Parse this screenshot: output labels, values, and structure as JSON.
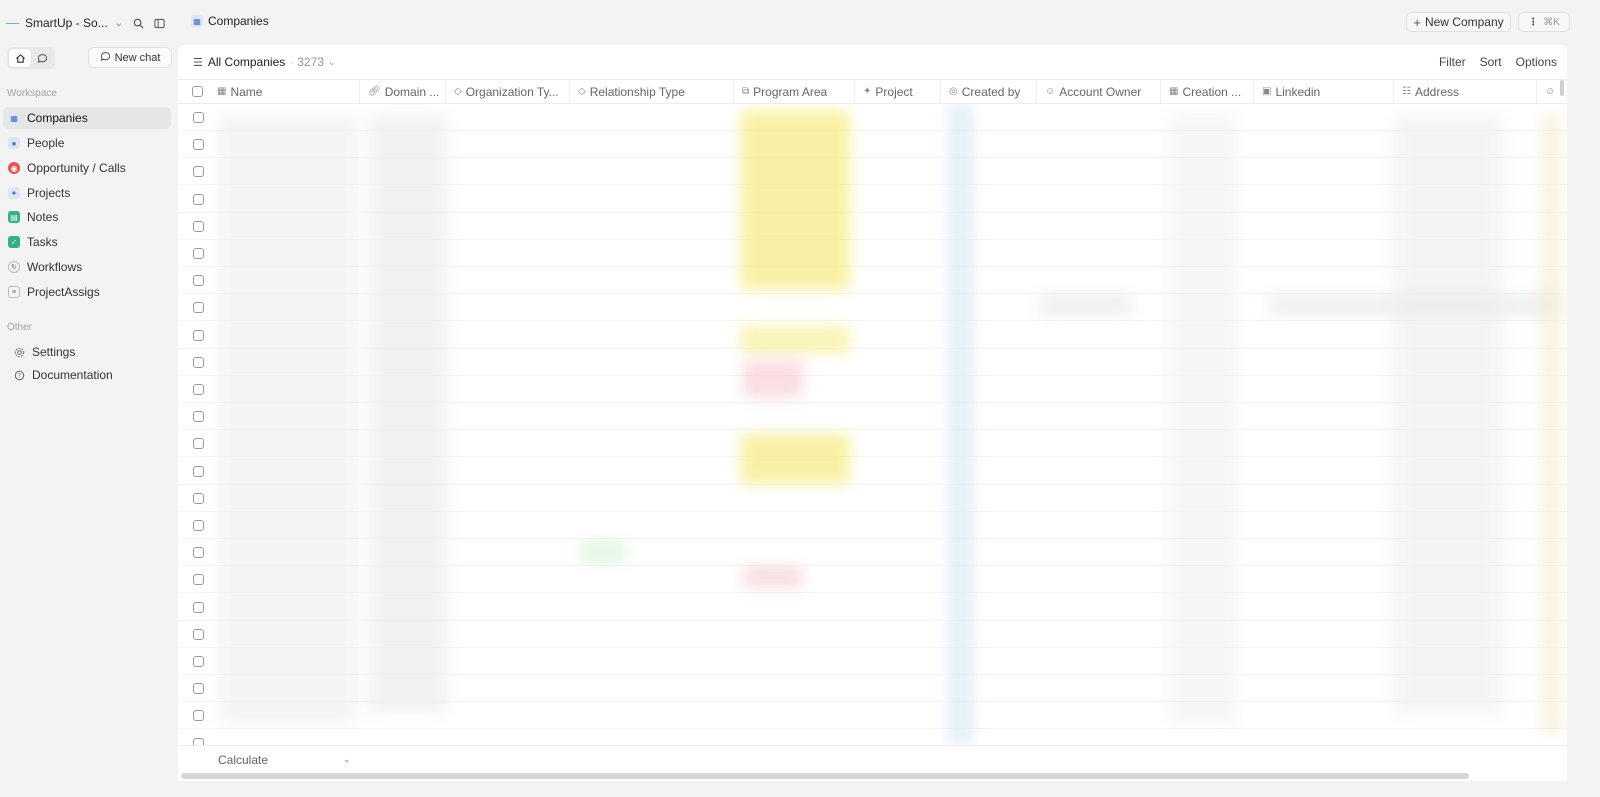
{
  "workspace": {
    "name": "SmartUp - So..."
  },
  "sidebar": {
    "new_chat_label": "New chat",
    "workspace_label": "Workspace",
    "other_label": "Other",
    "items": [
      {
        "label": "Companies",
        "icon": "building-icon",
        "color": "#5b7fd0"
      },
      {
        "label": "People",
        "icon": "person-icon",
        "color": "#5b7fd0"
      },
      {
        "label": "Opportunity / Calls",
        "icon": "target-icon",
        "color": "#d94b4b"
      },
      {
        "label": "Projects",
        "icon": "rocket-icon",
        "color": "#5b7fd0"
      },
      {
        "label": "Notes",
        "icon": "note-icon",
        "color": "#2fae7a"
      },
      {
        "label": "Tasks",
        "icon": "checkbox-icon",
        "color": "#2fae7a"
      },
      {
        "label": "Workflows",
        "icon": "workflow-icon",
        "color": "#888888"
      },
      {
        "label": "ProjectAssigs",
        "icon": "list-icon",
        "color": "#888888"
      }
    ],
    "other_items": [
      {
        "label": "Settings",
        "icon": "gear-icon"
      },
      {
        "label": "Documentation",
        "icon": "help-icon"
      }
    ]
  },
  "header": {
    "title": "Companies",
    "new_company_label": "New Company",
    "shortcut": "⌘K"
  },
  "view": {
    "name": "All Companies",
    "count": "3273",
    "filter_label": "Filter",
    "sort_label": "Sort",
    "options_label": "Options"
  },
  "columns": [
    {
      "label": "Name",
      "icon": "building-icon"
    },
    {
      "label": "Domain ...",
      "icon": "link-icon"
    },
    {
      "label": "Organization Ty...",
      "icon": "tag-icon"
    },
    {
      "label": "Relationship Type",
      "icon": "tags-icon"
    },
    {
      "label": "Program Area",
      "icon": "layers-icon"
    },
    {
      "label": "Project",
      "icon": "rocket-icon"
    },
    {
      "label": "Created by",
      "icon": "at-icon"
    },
    {
      "label": "Account Owner",
      "icon": "user-circle-icon"
    },
    {
      "label": "Creation ...",
      "icon": "calendar-icon"
    },
    {
      "label": "Linkedin",
      "icon": "linkedin-icon"
    },
    {
      "label": "Address",
      "icon": "map-icon"
    }
  ],
  "footer": {
    "calculate_label": "Calculate"
  }
}
